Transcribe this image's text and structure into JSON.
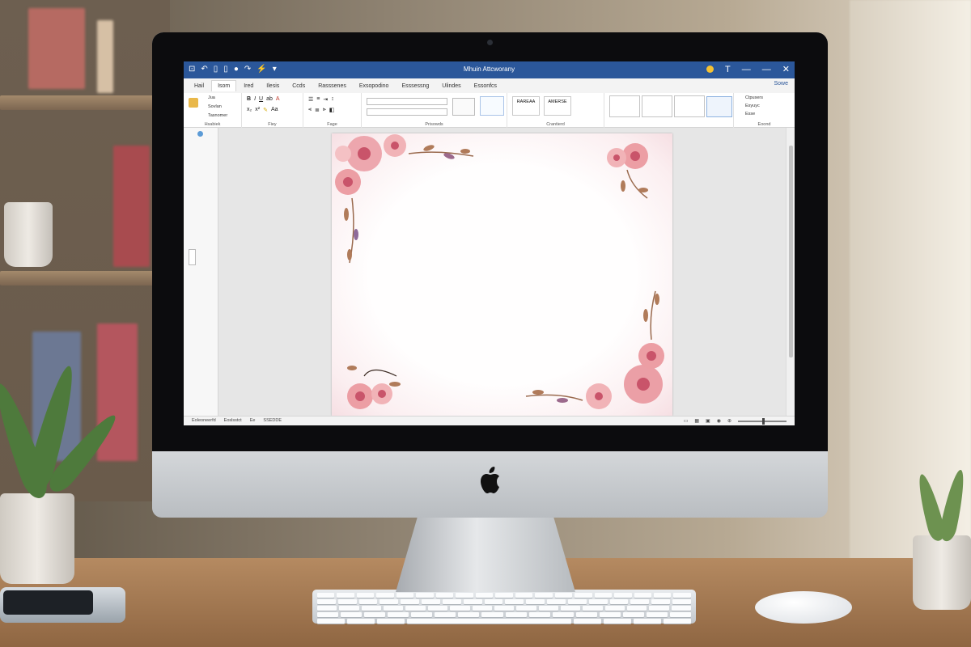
{
  "word_window": {
    "title": "Mhuin Attcworany",
    "quick_access": [
      "⊡",
      "↶",
      "▯",
      "▯",
      "●",
      "↷",
      "⚡",
      "▾"
    ],
    "window_controls": [
      "T",
      "—",
      "—",
      "✕"
    ],
    "tabs": [
      "Hail",
      "Isom",
      "Ired",
      "Ilesis",
      "Ccds",
      "Rasssenes",
      "Exsopodino",
      "Esssessng",
      "Ulindes",
      "Essonfcs"
    ],
    "share_label": "Sowe",
    "ribbon": {
      "groups": [
        "Hsabiek",
        "Fiey",
        "Fage",
        "Prisowds",
        "Crantierd",
        "Eoond"
      ],
      "clipboard_items": [
        "Jua",
        "Sovlan",
        "Tasnomer"
      ],
      "styles": [
        "RAREAA",
        "AMERSE"
      ],
      "right_items": [
        "Ctpusers",
        "Esyuyc",
        "Esse"
      ]
    },
    "status_left": [
      "Eoleoneerfd",
      "Eoslsstct",
      "Ee",
      "SSEDDE"
    ],
    "status_right_icons": [
      "layout-icon",
      "read-icon",
      "print-icon",
      "web-icon",
      "zoom-icon"
    ]
  },
  "colors": {
    "title_bar": "#2b579a",
    "page_border_flowers": "#e8a3a8",
    "flower_center": "#c9546a",
    "leaves": "#9a6a4e"
  }
}
